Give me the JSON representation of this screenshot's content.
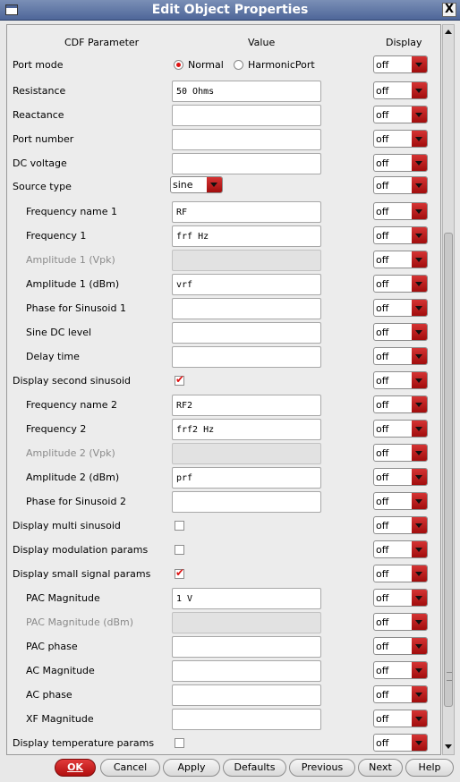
{
  "window": {
    "title": "Edit Object Properties",
    "close_glyph": "X"
  },
  "headers": {
    "param": "CDF Parameter",
    "value": "Value",
    "display": "Display"
  },
  "port_mode": {
    "label": "Port mode",
    "option1": "Normal",
    "option2": "HarmonicPort",
    "selected": "Normal"
  },
  "source_type_value": "sine",
  "display_option": "off",
  "rows": {
    "resistance": {
      "label": "Resistance",
      "value": "50 Ohms"
    },
    "reactance": {
      "label": "Reactance",
      "value": ""
    },
    "port_number": {
      "label": "Port number",
      "value": ""
    },
    "dc_voltage": {
      "label": "DC voltage",
      "value": ""
    },
    "source_type": {
      "label": "Source type"
    },
    "freq_name1": {
      "label": "Frequency name 1",
      "value": "RF"
    },
    "freq1": {
      "label": "Frequency 1",
      "value": "frf Hz"
    },
    "amp1_vpk": {
      "label": "Amplitude 1 (Vpk)",
      "value": ""
    },
    "amp1_dbm": {
      "label": "Amplitude 1 (dBm)",
      "value": "vrf"
    },
    "phase1": {
      "label": "Phase for Sinusoid 1",
      "value": ""
    },
    "sine_dc": {
      "label": "Sine DC level",
      "value": ""
    },
    "delay": {
      "label": "Delay time",
      "value": ""
    },
    "disp_second": {
      "label": "Display second sinusoid",
      "checked": true
    },
    "freq_name2": {
      "label": "Frequency name 2",
      "value": "RF2"
    },
    "freq2": {
      "label": "Frequency 2",
      "value": "frf2 Hz"
    },
    "amp2_vpk": {
      "label": "Amplitude 2 (Vpk)",
      "value": ""
    },
    "amp2_dbm": {
      "label": "Amplitude 2 (dBm)",
      "value": "prf"
    },
    "phase2": {
      "label": "Phase for Sinusoid 2",
      "value": ""
    },
    "disp_multi": {
      "label": "Display multi sinusoid",
      "checked": false
    },
    "disp_mod": {
      "label": "Display modulation params",
      "checked": false
    },
    "disp_small": {
      "label": "Display small signal params",
      "checked": true
    },
    "pac_mag": {
      "label": "PAC Magnitude",
      "value": "1 V"
    },
    "pac_mag_dbm": {
      "label": "PAC Magnitude (dBm)",
      "value": ""
    },
    "pac_phase": {
      "label": "PAC phase",
      "value": ""
    },
    "ac_mag": {
      "label": "AC Magnitude",
      "value": ""
    },
    "ac_phase": {
      "label": "AC phase",
      "value": ""
    },
    "xf_mag": {
      "label": "XF Magnitude",
      "value": ""
    },
    "disp_temp": {
      "label": "Display temperature params",
      "checked": false
    }
  },
  "buttons": {
    "ok": "OK",
    "cancel": "Cancel",
    "apply": "Apply",
    "defaults": "Defaults",
    "previous": "Previous",
    "next": "Next",
    "help": "Help"
  },
  "colors": {
    "titlebar": "#4e6699",
    "accent_red": "#c41b1b",
    "panel_bg": "#ececec"
  }
}
